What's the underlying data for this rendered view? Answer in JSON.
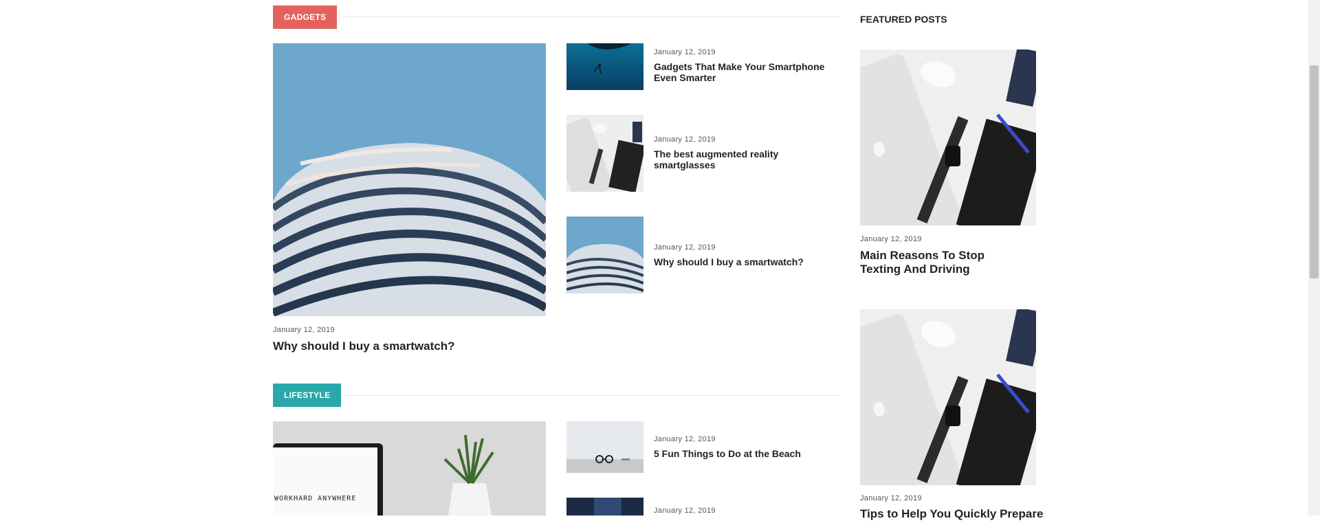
{
  "sections": [
    {
      "badge": "GADGETS",
      "badge_color": "#e4625d",
      "main_post": {
        "date": "January 12, 2019",
        "title": "Why should I buy a smartwatch?",
        "image": "curved-building"
      },
      "list": [
        {
          "date": "January 12, 2019",
          "title": "Gadgets That Make Your Smartphone Even Smarter",
          "image": "diver-underwater"
        },
        {
          "date": "January 12, 2019",
          "title": "The best augmented reality smartglasses",
          "image": "desk-flatlay"
        },
        {
          "date": "January 12, 2019",
          "title": "Why should I buy a smartwatch?",
          "image": "curved-building"
        }
      ]
    },
    {
      "badge": "LIFESTYLE",
      "badge_color": "#2aa7aa",
      "main_post": {
        "date": "",
        "title": "",
        "image": "laptop-plant",
        "image_text": "WORKHARD ANYWHERE"
      },
      "list": [
        {
          "date": "January 12, 2019",
          "title": "5 Fun Things to Do at the Beach",
          "image": "glasses-desk"
        },
        {
          "date": "January 12, 2019",
          "title": "",
          "image": "dark-blue"
        }
      ]
    }
  ],
  "sidebar": {
    "heading": "FEATURED POSTS",
    "posts": [
      {
        "date": "January 12, 2019",
        "title": "Main Reasons To Stop Texting And Driving",
        "image": "desk-flatlay"
      },
      {
        "date": "January 12, 2019",
        "title": "Tips to Help You Quickly Prepare",
        "image": "desk-flatlay"
      }
    ]
  },
  "colors": {
    "gadgets": "#e4625d",
    "lifestyle": "#2aa7aa",
    "text": "#222222"
  }
}
